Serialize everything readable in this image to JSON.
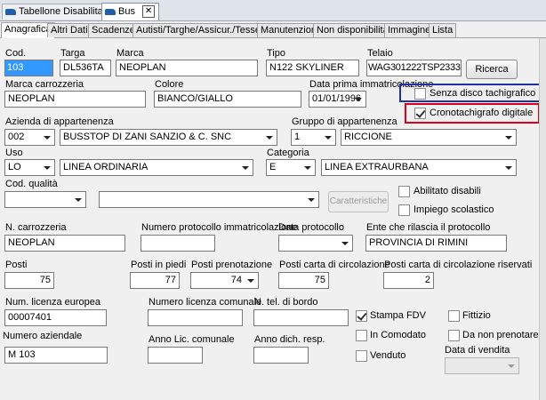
{
  "doc_tabs": [
    {
      "label": "Tabellone Disabilitato"
    },
    {
      "label": "Bus",
      "close": "✕"
    }
  ],
  "tabs": [
    "Anagrafica",
    "Altri Dati",
    "Scadenze",
    "Autisti/Targhe/Assicur./Tesser",
    "Manutenzioni",
    "Non disponibilità",
    "Immagine",
    "Lista"
  ],
  "fields": {
    "cod": {
      "label": "Cod.",
      "value": "103"
    },
    "targa": {
      "label": "Targa",
      "value": "DL536TA"
    },
    "marca": {
      "label": "Marca",
      "value": "NEOPLAN"
    },
    "tipo": {
      "label": "Tipo",
      "value": "N122 SKYLINER"
    },
    "telaio": {
      "label": "Telaio",
      "value": "WAG301222TSP23335"
    },
    "ricerca_button": "Ricerca",
    "marca_carrozzeria": {
      "label": "Marca carrozzeria",
      "value": "NEOPLAN"
    },
    "colore": {
      "label": "Colore",
      "value": "BIANCO/GIALLO"
    },
    "data_prima": {
      "label": "Data prima immatricolazione",
      "value": "01/01/1996"
    },
    "senza_disco": {
      "label": "Senza disco tachigrafico",
      "checked": false
    },
    "cronotachigrafo": {
      "label": "Cronotachigrafo digitale",
      "checked": true
    },
    "azienda": {
      "label": "Azienda di appartenenza",
      "code": "002",
      "name": "BUSSTOP DI ZANI SANZIO & C. SNC"
    },
    "gruppo": {
      "label": "Gruppo di appartenenza",
      "code": "1",
      "name": "RICCIONE"
    },
    "uso": {
      "label": "Uso",
      "code": "LO",
      "name": "LINEA ORDINARIA"
    },
    "categoria": {
      "label": "Categoria",
      "code": "E",
      "name": "LINEA EXTRAURBANA"
    },
    "cod_qualita": {
      "label": "Cod. qualità",
      "code": "",
      "name": ""
    },
    "caratteristiche_button": "Caratteristiche",
    "abilitato_disabili": {
      "label": "Abilitato disabili",
      "checked": false
    },
    "impiego_scolastico": {
      "label": "Impiego scolastico",
      "checked": false
    },
    "n_carrozzeria": {
      "label": "N. carrozzeria",
      "value": "NEOPLAN"
    },
    "num_protocollo": {
      "label": "Numero protocollo immatricolazione",
      "value": ""
    },
    "data_protocollo": {
      "label": "Data protocollo",
      "value": ""
    },
    "ente_protocollo": {
      "label": "Ente che rilascia il protocollo",
      "value": "PROVINCIA DI RIMINI"
    },
    "posti": {
      "label": "Posti",
      "value": "75"
    },
    "posti_in_piedi": {
      "label": "Posti in piedi",
      "value": "77"
    },
    "posti_prenotazione": {
      "label": "Posti prenotazione",
      "value": "74"
    },
    "posti_carta": {
      "label": "Posti carta di circolazione",
      "value": "75"
    },
    "posti_carta_riservati": {
      "label": "Posti carta di circolazione riservati",
      "value": "2"
    },
    "num_licenza_europea": {
      "label": "Num. licenza europea",
      "value": "00007401"
    },
    "num_licenza_comunale": {
      "label": "Numero licenza comunale",
      "value": ""
    },
    "tel_bordo": {
      "label": "N. tel. di bordo",
      "value": ""
    },
    "stampa_fdv": {
      "label": "Stampa FDV",
      "checked": true
    },
    "fittizio": {
      "label": "Fittizio",
      "checked": false
    },
    "in_comodato": {
      "label": "In Comodato",
      "checked": false
    },
    "da_non_prenotare": {
      "label": "Da non prenotare",
      "checked": false
    },
    "numero_aziendale": {
      "label": "Numero aziendale",
      "value": "M 103"
    },
    "anno_lic_comunale": {
      "label": "Anno Lic. comunale",
      "value": ""
    },
    "anno_dich_resp": {
      "label": "Anno dich. resp.",
      "value": ""
    },
    "venduto": {
      "label": "Venduto",
      "checked": false
    },
    "data_vendita": {
      "label": "Data di vendita",
      "value": ""
    }
  },
  "highlight_colors": {
    "blue": "#1f2fa8",
    "red": "#d9001b"
  }
}
